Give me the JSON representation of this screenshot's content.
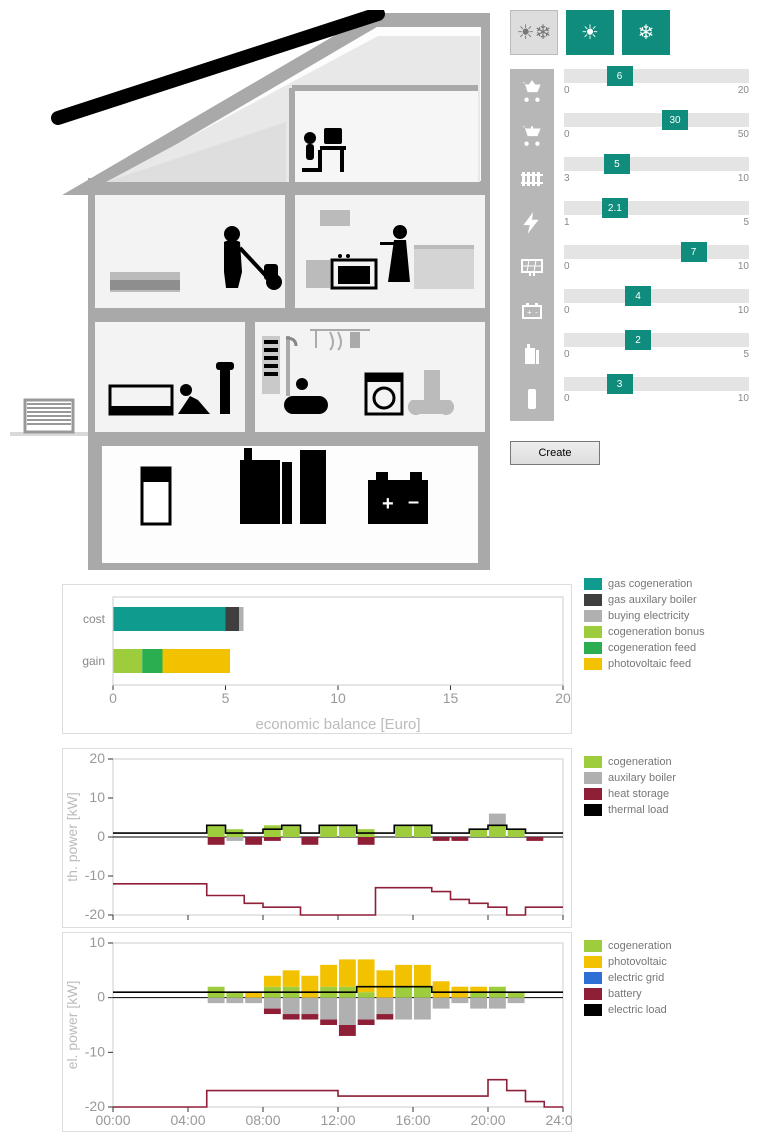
{
  "modes": [
    {
      "name": "transition-mode",
      "icon": "☀❄",
      "active": false
    },
    {
      "name": "summer-mode",
      "icon": "☀",
      "active": true
    },
    {
      "name": "winter-mode",
      "icon": "❄",
      "active": true
    }
  ],
  "sliders": [
    {
      "name": "export-price",
      "icon": "cart-up",
      "min": 0,
      "max": 20,
      "value": 6
    },
    {
      "name": "import-price",
      "icon": "cart-down",
      "min": 0,
      "max": 50,
      "value": 30
    },
    {
      "name": "heating",
      "icon": "radiator",
      "min": 3,
      "max": 10,
      "value": 5
    },
    {
      "name": "el-base",
      "icon": "bolt",
      "min": 1,
      "max": 5,
      "value": 2.1
    },
    {
      "name": "pv-size",
      "icon": "pv",
      "min": 0,
      "max": 10,
      "value": 7
    },
    {
      "name": "battery-cap",
      "icon": "battery",
      "min": 0,
      "max": 10,
      "value": 4
    },
    {
      "name": "chp-size",
      "icon": "chp",
      "min": 0,
      "max": 5,
      "value": 2
    },
    {
      "name": "storage-cap",
      "icon": "tank",
      "min": 0,
      "max": 10,
      "value": 3
    }
  ],
  "buttons": {
    "create": "Create"
  },
  "colors": {
    "teal": "#0f9b8e",
    "dark": "#3f3f3f",
    "grey": "#b0b0b0",
    "lime": "#9dcc3c",
    "green": "#2bae4f",
    "yellow": "#f2c200",
    "crimson": "#8e1f37",
    "black": "#000000",
    "blue": "#2d6fd4"
  },
  "house_scene": {
    "rooms": [
      "attic-office",
      "kitchen",
      "living-vacuum",
      "living-sofa",
      "bathroom",
      "laundry",
      "basement-utility"
    ],
    "equipment": [
      "solar-panel",
      "heat-pump-outdoor",
      "hot-water-tank",
      "chp-unit",
      "thermal-storage",
      "battery"
    ]
  },
  "chart_data": [
    {
      "type": "bar",
      "title": "economic balance [Euro]",
      "xlabel": "economic balance [Euro]",
      "xlim": [
        0,
        20
      ],
      "xticks": [
        0,
        5,
        10,
        15,
        20
      ],
      "categories": [
        "cost",
        "gain"
      ],
      "series": [
        {
          "name": "gas cogeneration",
          "color": "teal",
          "values": [
            5.0,
            0
          ]
        },
        {
          "name": "gas auxilary boiler",
          "color": "dark",
          "values": [
            0.6,
            0
          ]
        },
        {
          "name": "buying electricity",
          "color": "grey",
          "values": [
            0.2,
            0
          ]
        },
        {
          "name": "cogeneration bonus",
          "color": "lime",
          "values": [
            0,
            1.3
          ]
        },
        {
          "name": "cogeneration feed",
          "color": "green",
          "values": [
            0,
            0.9
          ]
        },
        {
          "name": "photovoltaic feed",
          "color": "yellow",
          "values": [
            0,
            3.0
          ]
        }
      ]
    },
    {
      "type": "bar+line",
      "ylabel": "th. power [kW]",
      "xlim": [
        0,
        24
      ],
      "ylim": [
        -20,
        20
      ],
      "xticks": [
        0,
        4,
        8,
        12,
        16,
        20,
        24
      ],
      "yticks": [
        -20,
        -10,
        0,
        10,
        20
      ],
      "series_bar": [
        {
          "name": "cogeneration",
          "color": "lime",
          "values": [
            0,
            0,
            0,
            0,
            0,
            3,
            2,
            0,
            3,
            3,
            0,
            3,
            3,
            2,
            0,
            3,
            3,
            0,
            0,
            2,
            3,
            2,
            0,
            0
          ]
        },
        {
          "name": "auxilary boiler",
          "color": "grey",
          "values": [
            0,
            0,
            0,
            0,
            0,
            0,
            -1,
            0,
            0,
            0,
            0,
            0,
            0,
            0,
            0,
            0,
            0,
            0,
            0,
            0,
            3,
            0,
            0,
            0
          ]
        },
        {
          "name": "heat storage",
          "color": "crimson",
          "values": [
            0,
            0,
            0,
            0,
            0,
            -2,
            0,
            -2,
            -1,
            0,
            -2,
            0,
            0,
            -2,
            0,
            0,
            0,
            -1,
            -1,
            0,
            0,
            0,
            -1,
            0
          ]
        }
      ],
      "series_line": [
        {
          "name": "thermal load",
          "color": "black",
          "values": [
            1,
            1,
            1,
            1,
            1,
            3,
            1,
            1,
            2,
            3,
            1,
            3,
            3,
            1,
            1,
            3,
            3,
            1,
            1,
            2,
            3,
            2,
            1,
            1
          ]
        },
        {
          "name": "storage-soc",
          "color": "crimson",
          "values": [
            -12,
            -12,
            -12,
            -12,
            -12,
            -15,
            -15,
            -17,
            -18,
            -18,
            -20,
            -20,
            -20,
            -20,
            -13,
            -13,
            -13,
            -14,
            -16,
            -17,
            -18,
            -20,
            -18,
            -18
          ]
        }
      ],
      "legend": [
        {
          "name": "cogeneration",
          "color": "lime"
        },
        {
          "name": "auxilary boiler",
          "color": "grey"
        },
        {
          "name": "heat storage",
          "color": "crimson"
        },
        {
          "name": "thermal load",
          "color": "black"
        }
      ]
    },
    {
      "type": "bar+line",
      "ylabel": "el. power [kW]",
      "xlim": [
        0,
        24
      ],
      "ylim": [
        -20,
        10
      ],
      "xticks": [
        0,
        4,
        8,
        12,
        16,
        20,
        24
      ],
      "xtick_labels": [
        "00:00",
        "04:00",
        "08:00",
        "12:00",
        "16:00",
        "20:00",
        "24:00"
      ],
      "yticks": [
        -20,
        -10,
        0,
        10
      ],
      "series_bar": [
        {
          "name": "cogeneration",
          "color": "lime",
          "values": [
            0,
            0,
            0,
            0,
            0,
            2,
            1,
            0,
            2,
            2,
            0,
            2,
            2,
            1,
            0,
            2,
            2,
            0,
            0,
            1,
            2,
            1,
            0,
            0
          ]
        },
        {
          "name": "photovoltaic",
          "color": "yellow",
          "values": [
            0,
            0,
            0,
            0,
            0,
            0,
            0,
            1,
            2,
            3,
            4,
            4,
            5,
            6,
            5,
            4,
            4,
            3,
            2,
            1,
            0,
            0,
            0,
            0
          ]
        },
        {
          "name": "electric grid",
          "color": "grey",
          "values": [
            0,
            0,
            0,
            0,
            0,
            -1,
            -1,
            -1,
            -2,
            -3,
            -3,
            -4,
            -5,
            -4,
            -3,
            -4,
            -4,
            -2,
            -1,
            -2,
            -2,
            -1,
            0,
            0
          ]
        },
        {
          "name": "battery",
          "color": "crimson",
          "values": [
            0,
            0,
            0,
            0,
            0,
            0,
            0,
            0,
            -1,
            -1,
            -1,
            -1,
            -2,
            -1,
            -1,
            0,
            0,
            0,
            0,
            0,
            0,
            0,
            0,
            0
          ]
        }
      ],
      "series_line": [
        {
          "name": "electric load",
          "color": "black",
          "values": [
            1,
            1,
            1,
            1,
            1,
            1,
            1,
            1,
            1,
            1,
            1,
            1,
            1,
            2,
            2,
            2,
            2,
            1,
            1,
            1,
            1,
            1,
            1,
            1
          ]
        },
        {
          "name": "battery-soc",
          "color": "crimson",
          "values": [
            -20,
            -20,
            -20,
            -20,
            -20,
            -17,
            -17,
            -17,
            -17,
            -17,
            -17,
            -17,
            -18,
            -18,
            -18,
            -18,
            -18,
            -18,
            -18,
            -18,
            -15,
            -17,
            -19,
            -20
          ]
        }
      ],
      "legend": [
        {
          "name": "cogeneration",
          "color": "lime"
        },
        {
          "name": "photovoltaic",
          "color": "yellow"
        },
        {
          "name": "electric grid",
          "color": "blue"
        },
        {
          "name": "battery",
          "color": "crimson"
        },
        {
          "name": "electric load",
          "color": "black"
        }
      ]
    }
  ]
}
